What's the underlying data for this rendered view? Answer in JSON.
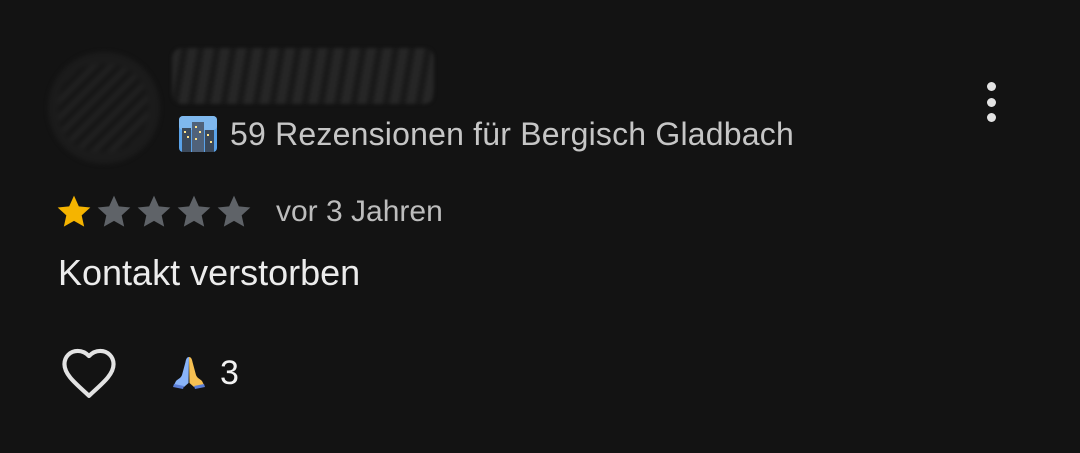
{
  "review": {
    "reviews_count_text": "59 Rezensionen für Bergisch Gladbach",
    "rating": 1,
    "rating_max": 5,
    "date_text": "vor 3 Jahren",
    "body_text": "Kontakt verstorben",
    "reaction_emoji": "🙏",
    "reaction_count": "3"
  },
  "icons": {
    "city": "cityscape-icon",
    "more": "more-vert-icon",
    "like": "heart-outline-icon",
    "reaction": "folded-hands-emoji"
  },
  "colors": {
    "background": "#131313",
    "star_filled": "#f5b400",
    "star_empty": "#5f6368",
    "text_primary": "#ececec",
    "text_secondary": "#c6c6c6"
  }
}
